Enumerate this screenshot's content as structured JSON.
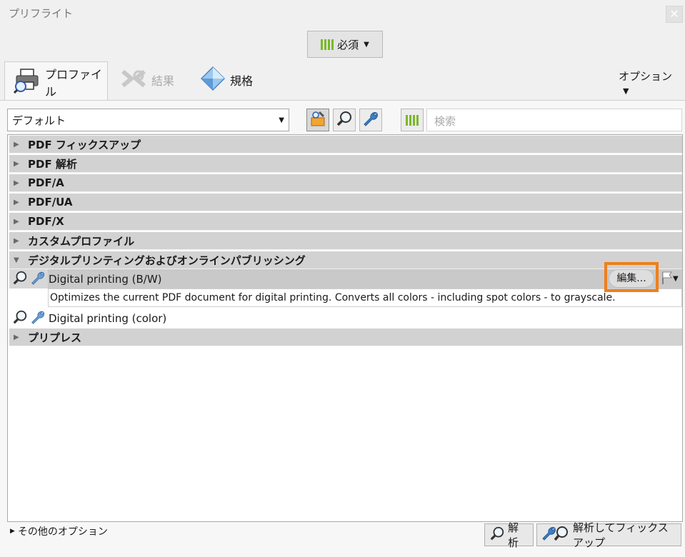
{
  "window": {
    "title": "プリフライト",
    "close_icon": "close-icon"
  },
  "toolbar": {
    "required_label": "必須"
  },
  "tabs": [
    {
      "label": "プロファイル",
      "icon": "printer-magnifier-icon",
      "active": true
    },
    {
      "label": "結果",
      "icon": "results-icon",
      "active": false
    },
    {
      "label": "規格",
      "icon": "diamond-icon",
      "active": false
    }
  ],
  "options": {
    "label": "オプション"
  },
  "filter": {
    "selected": "デフォルト",
    "search_placeholder": "検索"
  },
  "list": {
    "groups": [
      {
        "label": "PDF フィックスアップ",
        "expanded": false
      },
      {
        "label": "PDF 解析",
        "expanded": false
      },
      {
        "label": "PDF/A",
        "expanded": false
      },
      {
        "label": "PDF/UA",
        "expanded": false
      },
      {
        "label": "PDF/X",
        "expanded": false
      },
      {
        "label": "カスタムプロファイル",
        "expanded": false
      },
      {
        "label": "デジタルプリンティングおよびオンラインパブリッシング",
        "expanded": true
      },
      {
        "label": "プリプレス",
        "expanded": false
      }
    ],
    "items": [
      {
        "label": "Digital printing (B/W)",
        "description": "Optimizes the current PDF document for digital printing. Converts all colors - including spot colors - to grayscale.",
        "selected": true
      },
      {
        "label": "Digital printing (color)",
        "selected": false
      }
    ],
    "edit_label": "編集..."
  },
  "footer": {
    "more_options": "その他のオプション",
    "analyze": "解析",
    "analyze_fix": "解析してフィックスアップ"
  },
  "colors": {
    "highlight": "#f07f1b",
    "accent_green": "#7bb82a"
  }
}
